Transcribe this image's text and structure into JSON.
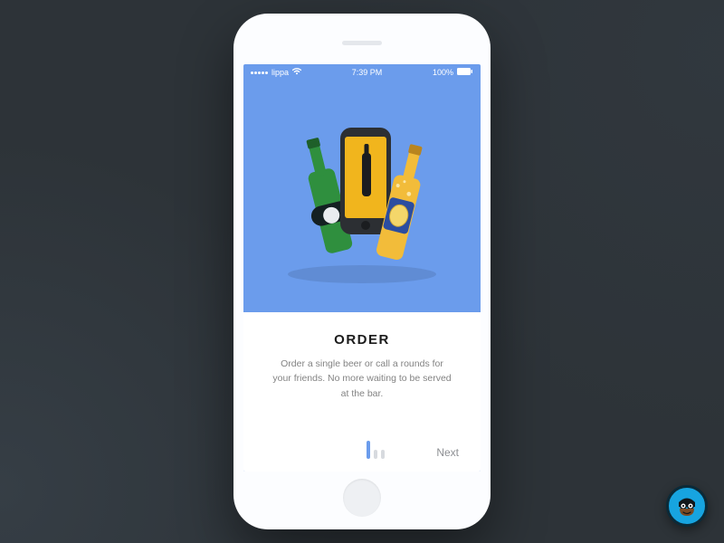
{
  "statusbar": {
    "carrier": "lippa",
    "time": "7:39 PM",
    "battery": "100%"
  },
  "onboarding": {
    "title": "ORDER",
    "body": "Order a single beer or call a rounds for your friends. No more waiting to be served at the bar.",
    "next_label": "Next",
    "page_index": 0,
    "page_count": 3
  },
  "colors": {
    "accent": "#6b9cec"
  }
}
